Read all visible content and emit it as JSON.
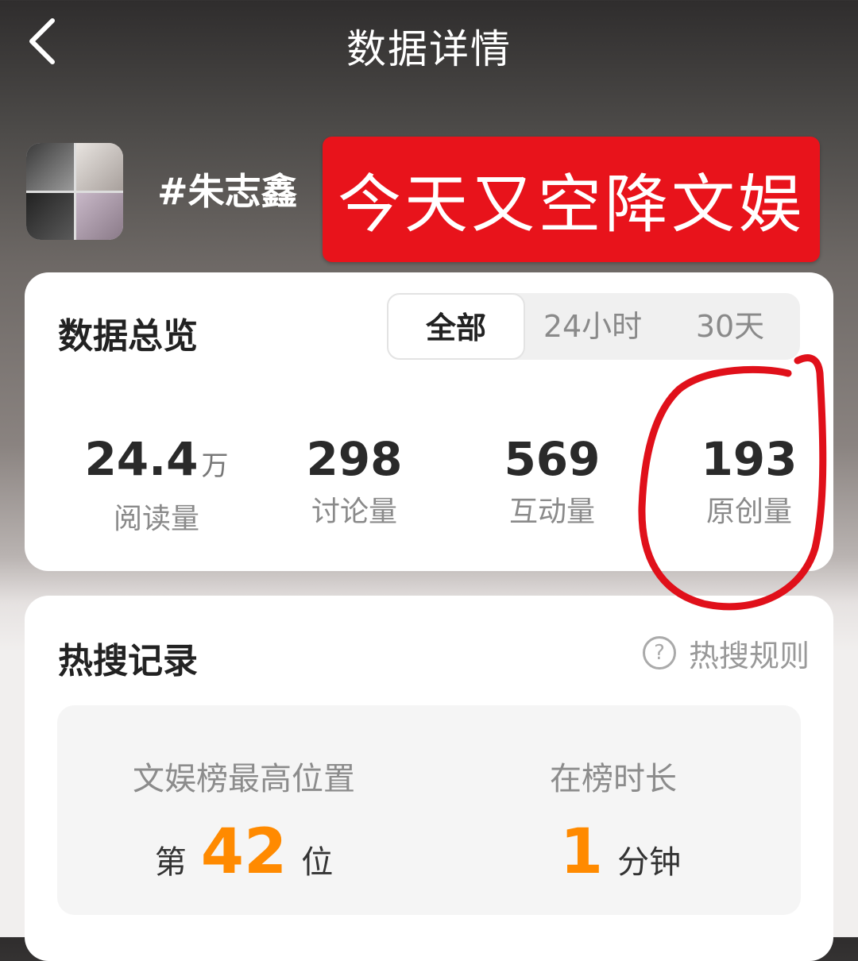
{
  "header": {
    "title": "数据详情"
  },
  "topic": {
    "name": "#朱志鑫"
  },
  "banner": {
    "text": "今天又空降文娱"
  },
  "overview": {
    "title": "数据总览",
    "tabs": [
      "全部",
      "24小时",
      "30天"
    ],
    "active_tab": "全部",
    "stats": [
      {
        "value": "24.4",
        "unit": "万",
        "label": "阅读量"
      },
      {
        "value": "298",
        "unit": "",
        "label": "讨论量"
      },
      {
        "value": "569",
        "unit": "",
        "label": "互动量"
      },
      {
        "value": "193",
        "unit": "",
        "label": "原创量"
      }
    ]
  },
  "hot_search": {
    "title": "热搜记录",
    "rules_label": "热搜规则",
    "best_rank": {
      "label": "文娱榜最高位置",
      "prefix": "第",
      "value": "42",
      "suffix": "位"
    },
    "duration": {
      "label": "在榜时长",
      "value": "1",
      "suffix": "分钟"
    }
  },
  "colors": {
    "banner": "#e8131b",
    "accent_orange": "#ff8a00",
    "annotation_red": "#e0101a"
  }
}
